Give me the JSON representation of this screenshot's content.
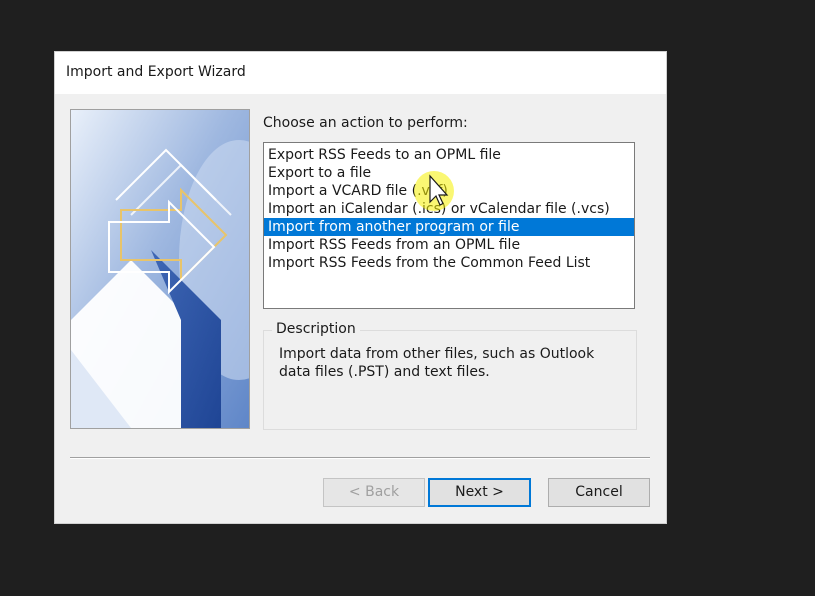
{
  "window": {
    "title": "Import and Export Wizard"
  },
  "wizard": {
    "prompt": "Choose an action to perform:",
    "actions": [
      "Export RSS Feeds to an OPML file",
      "Export to a file",
      "Import a VCARD file (.vcf)",
      "Import an iCalendar (.ics) or vCalendar file (.vcs)",
      "Import from another program or file",
      "Import RSS Feeds from an OPML file",
      "Import RSS Feeds from the Common Feed List"
    ],
    "selected_index": 4,
    "description": {
      "heading": "Description",
      "text": "Import data from other files, such as Outlook data files (.PST) and text files."
    }
  },
  "buttons": {
    "back": "< Back",
    "next": "Next >",
    "cancel": "Cancel"
  },
  "colors": {
    "selection": "#0078d7",
    "highlight_cursor": "#f5f000"
  }
}
